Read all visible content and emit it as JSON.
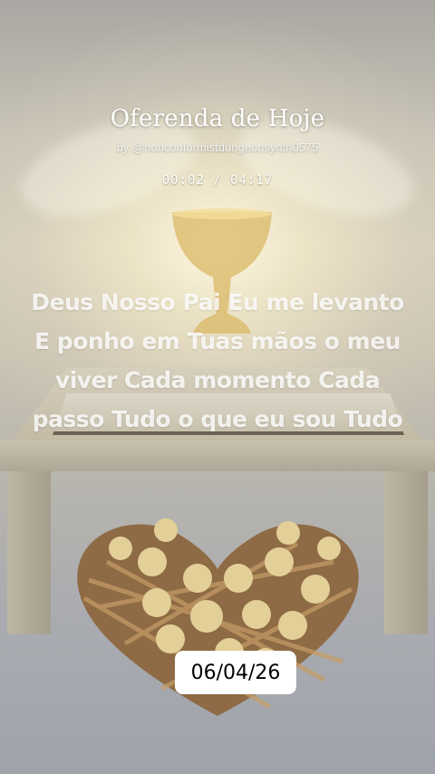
{
  "track": {
    "title": "Oferenda de Hoje",
    "author": "by @nonconformistdungeonsynth0575",
    "time_display": "00:02 / 04:17"
  },
  "lyrics": {
    "lines": [
      "Deus Nosso Pai Eu me levanto",
      "E ponho em Tuas mãos o meu",
      "viver Cada momento Cada",
      "passo Tudo o que eu sou Tudo"
    ]
  },
  "date_badge": {
    "text": "06/04/26"
  },
  "colors": {
    "text": "#ffffff",
    "badge_bg": "#ffffff",
    "badge_text": "#000000"
  }
}
